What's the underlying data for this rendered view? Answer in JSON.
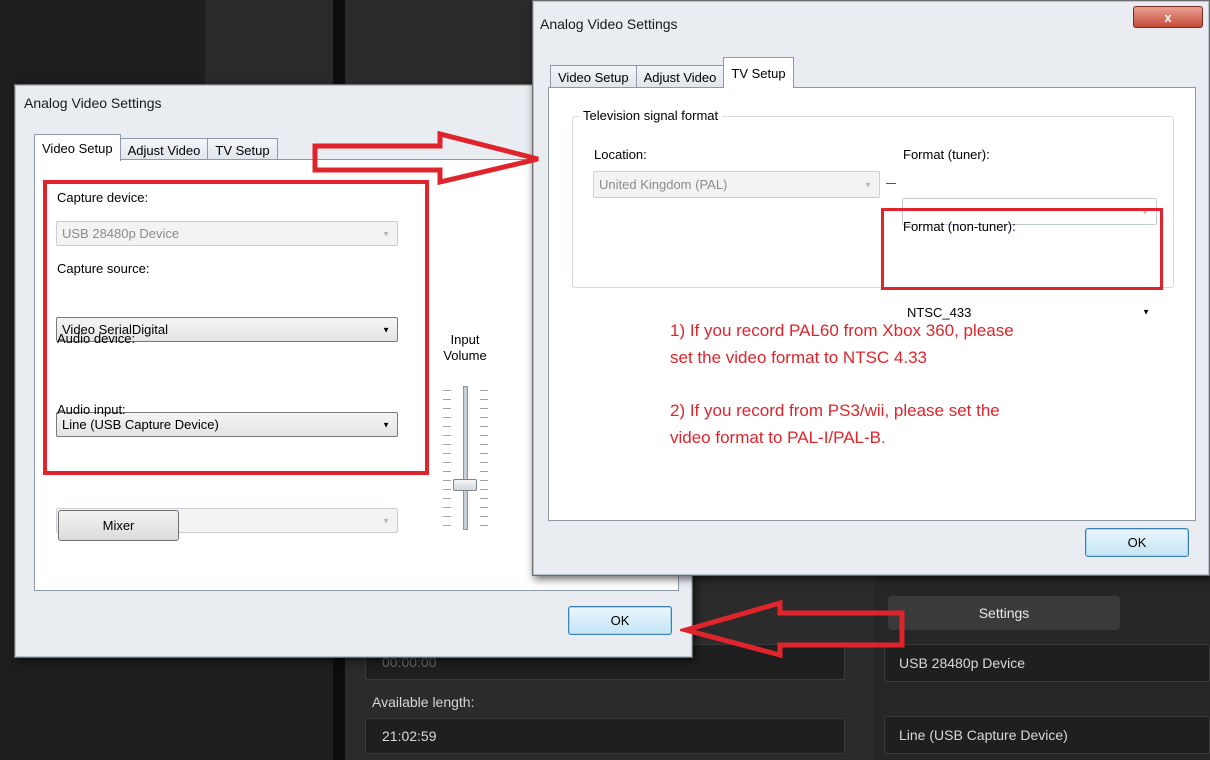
{
  "background": {
    "time_value": "00:00:00",
    "available_length_label": "Available length:",
    "available_length_value": "21:02:59",
    "settings_button": "Settings",
    "device_value": "USB 28480p Device",
    "audio_value": "Line (USB Capture Device)"
  },
  "dialog_left": {
    "title": "Analog Video Settings",
    "tabs": [
      "Video Setup",
      "Adjust Video",
      "TV Setup"
    ],
    "capture_device_label": "Capture device:",
    "capture_device_value": "USB 28480p Device",
    "capture_source_label": "Capture source:",
    "capture_source_value": "Video SerialDigital",
    "audio_device_label": "Audio device:",
    "audio_device_value": "Line (USB Capture Device)",
    "audio_input_label": "Audio input:",
    "audio_input_value": "",
    "input_volume_label_1": "Input",
    "input_volume_label_2": "Volume",
    "input_volume_level": 0.3,
    "mixer_button": "Mixer",
    "ok_button": "OK"
  },
  "dialog_right": {
    "title": "Analog Video Settings",
    "close_glyph": "x",
    "tabs": [
      "Video Setup",
      "Adjust Video",
      "TV Setup"
    ],
    "group_title": "Television signal format",
    "location_label": "Location:",
    "location_value": "United Kingdom (PAL)",
    "format_tuner_label": "Format (tuner):",
    "format_tuner_value": "",
    "format_nontuner_label": "Format (non-tuner):",
    "format_nontuner_value": "NTSC_433",
    "ok_button": "OK"
  },
  "annotations": {
    "note1_line1": "1) If you record PAL60 from Xbox 360, please",
    "note1_line2": "set the video format to NTSC 4.33",
    "note2_line1": "2) If you record from PS3/wii, please set the",
    "note2_line2": "video format to PAL-I/PAL-B."
  },
  "colors": {
    "annotation_red": "#e0242c",
    "dialog_bg": "#e9edf2",
    "app_bg": "#2b2b2b"
  },
  "icons": [
    "dropdown-arrow-icon",
    "close-icon",
    "arrow-right-icon",
    "arrow-left-icon"
  ]
}
